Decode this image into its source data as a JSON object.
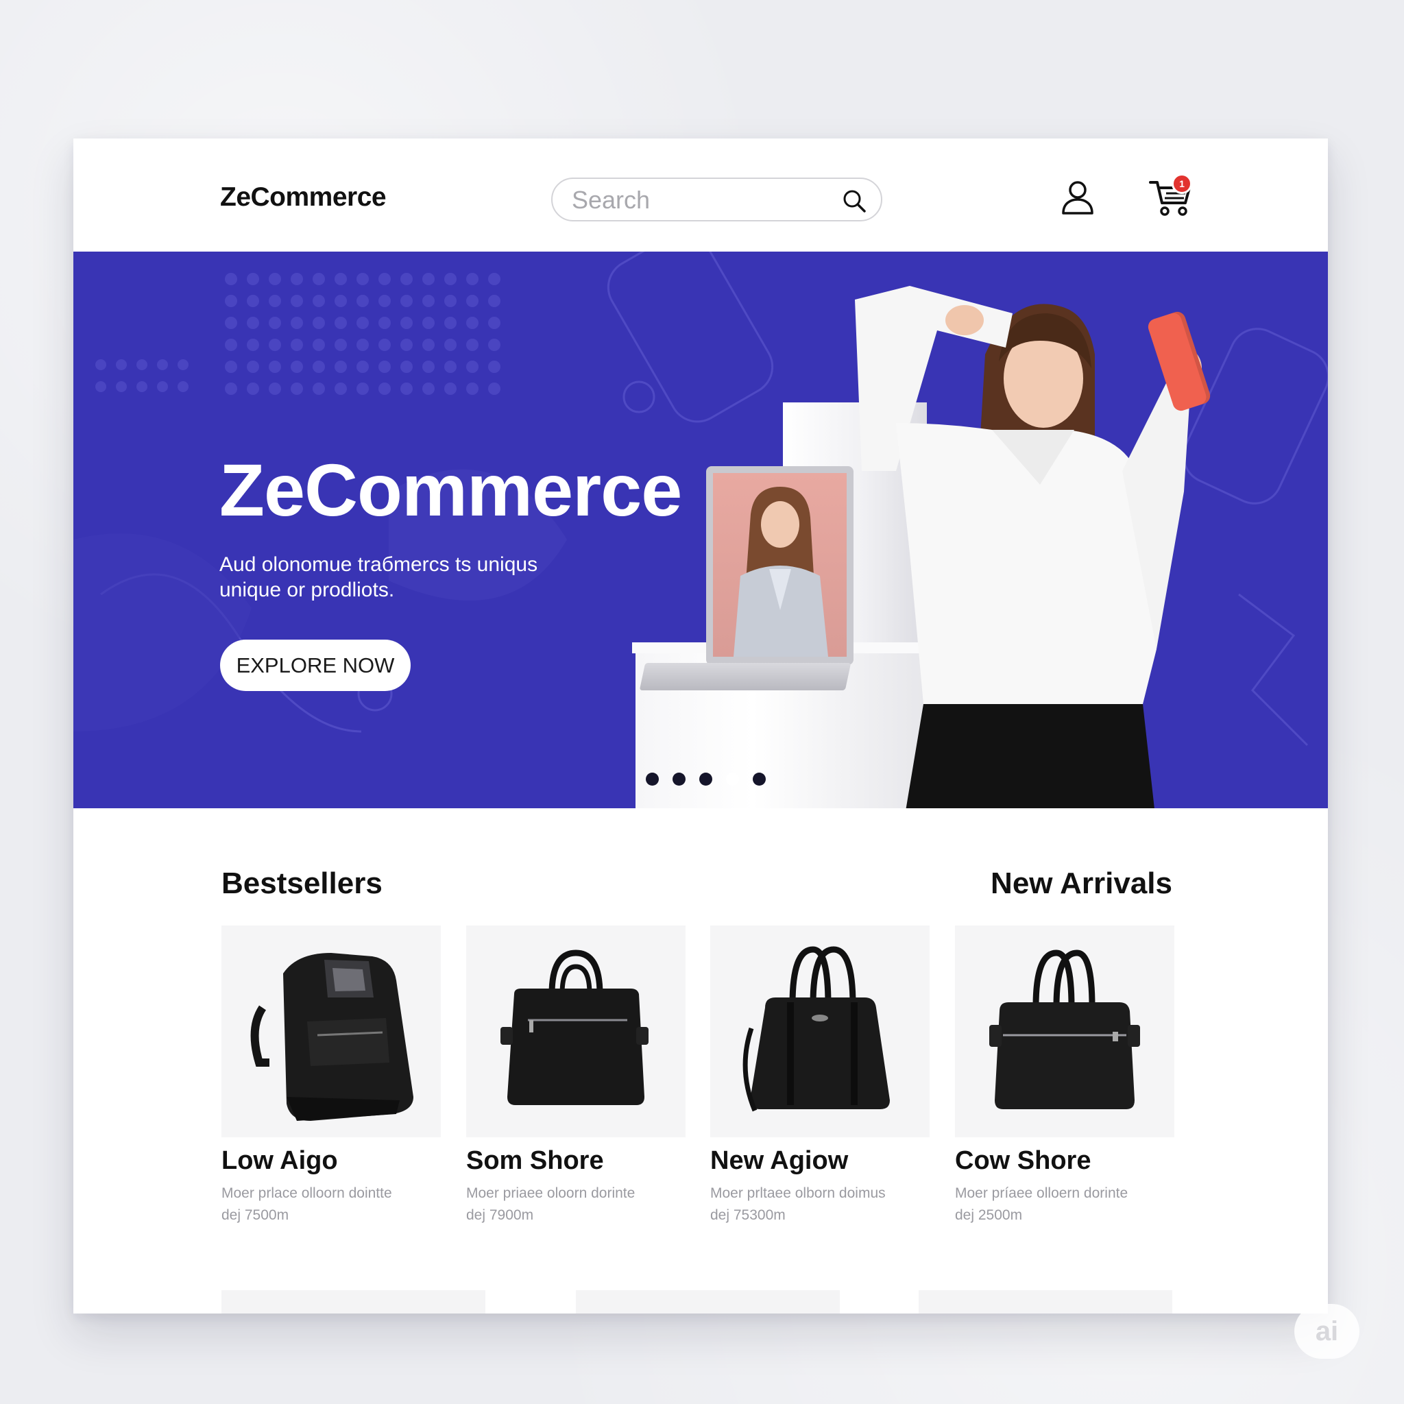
{
  "header": {
    "logo": "ZeCommerce",
    "search_placeholder": "Search",
    "cart_count": "1"
  },
  "hero": {
    "title": "ZeCommerce",
    "subtitle_line1": "Aud olonomue trабmercs ts uniqus",
    "subtitle_line2": "unique or prodliots.",
    "cta_label": "EXPLORE NOW",
    "slides_total": 5,
    "active_slide_index": 4,
    "background_color": "#3934b4"
  },
  "sections": {
    "bestsellers_title": "Bestsellers",
    "new_arrivals_title": "New Arrivals"
  },
  "products": [
    {
      "name": "Low Aigo",
      "desc_line1": "Moer prlace olloorn dointte",
      "desc_line2": "dej 7500m",
      "image": "backpack-icon"
    },
    {
      "name": "Som Shore",
      "desc_line1": "Moer priaee oloorn dorinte",
      "desc_line2": "dej 7900m",
      "image": "duffel-bag-icon"
    },
    {
      "name": "New Agiow",
      "desc_line1": "Moer prltaee olborn doimus",
      "desc_line2": "dej 75300m",
      "image": "handbag-icon"
    },
    {
      "name": "Cow Shore",
      "desc_line1": "Moer príaee olloern dorinte",
      "desc_line2": "dej 2500m",
      "image": "duffel-bag-icon"
    }
  ],
  "badge": {
    "text": "ai"
  },
  "colors": {
    "accent": "#3934b4",
    "badge": "#e2332f"
  }
}
